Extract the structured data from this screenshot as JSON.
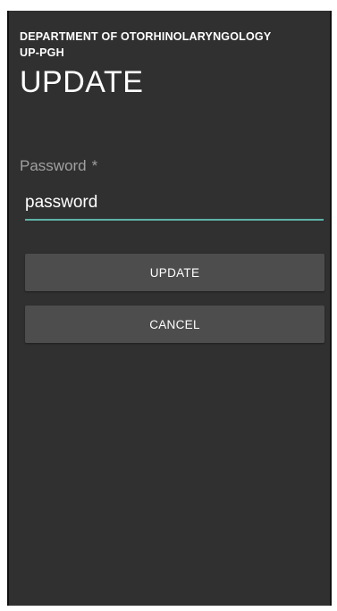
{
  "header": {
    "department_line1": "DEPARTMENT OF OTORHINOLARYNGOLOGY",
    "department_line2": "UP-PGH",
    "title": "UPDATE"
  },
  "form": {
    "password_label": "Password",
    "required_marker": "*",
    "password_value": "password"
  },
  "buttons": {
    "update_label": "UPDATE",
    "cancel_label": "CANCEL"
  },
  "colors": {
    "background": "#303030",
    "accent_underline": "#5fb3a8",
    "button": "#4d4d4d"
  }
}
